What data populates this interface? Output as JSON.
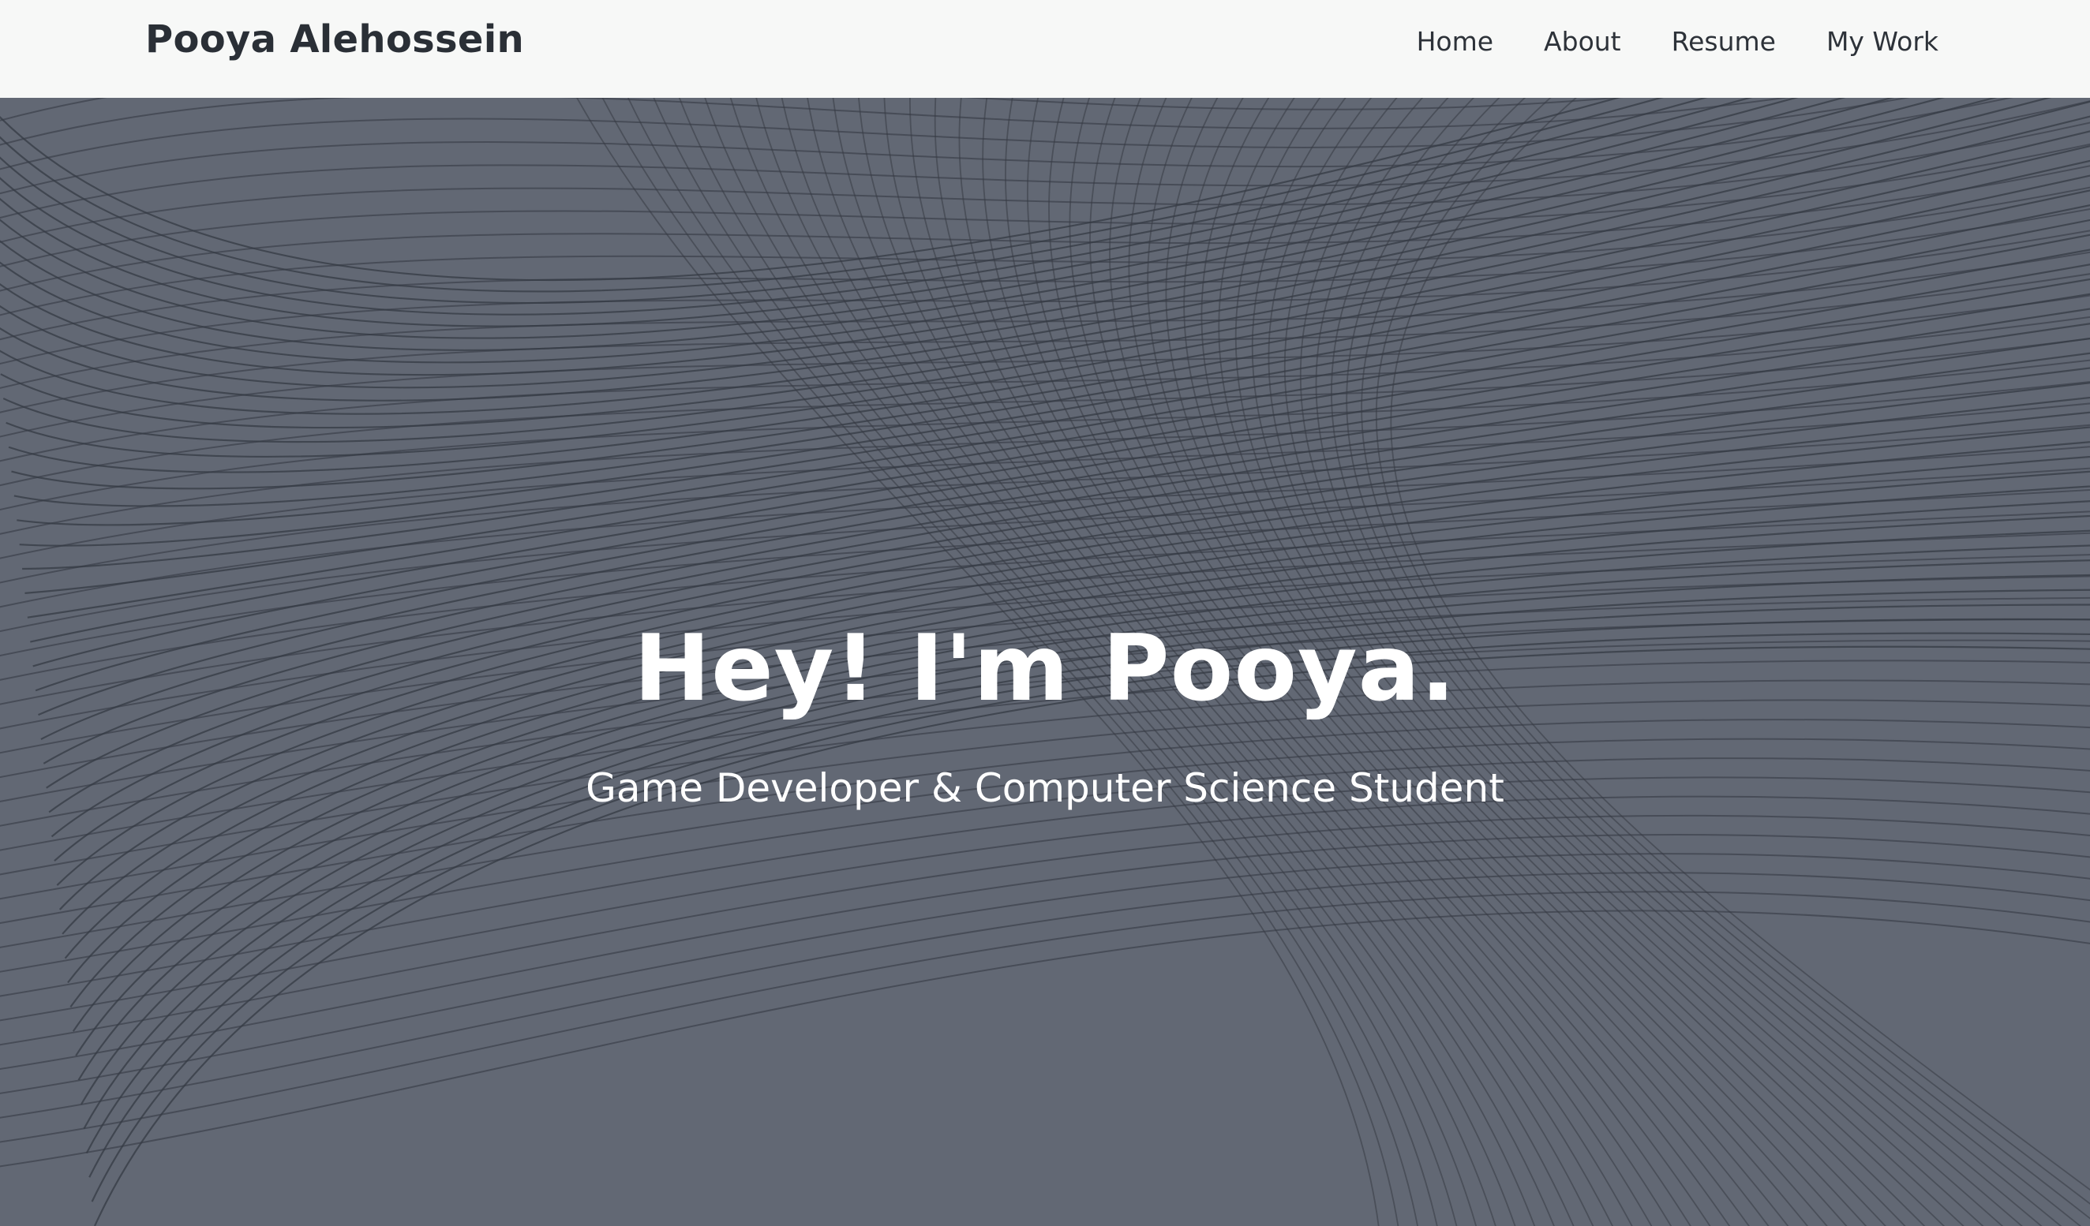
{
  "header": {
    "brand": "Pooya Alehossein",
    "nav": [
      {
        "label": "Home"
      },
      {
        "label": "About"
      },
      {
        "label": "Resume"
      },
      {
        "label": "My Work"
      }
    ]
  },
  "hero": {
    "title": "Hey! I'm Pooya.",
    "subtitle": "Game Developer & Computer Science Student"
  },
  "colors": {
    "navbar_bg": "#f7f8f7",
    "hero_bg": "#626874",
    "line": "#363b44",
    "text_light": "#ffffff",
    "text_dark": "#2a2f36"
  }
}
